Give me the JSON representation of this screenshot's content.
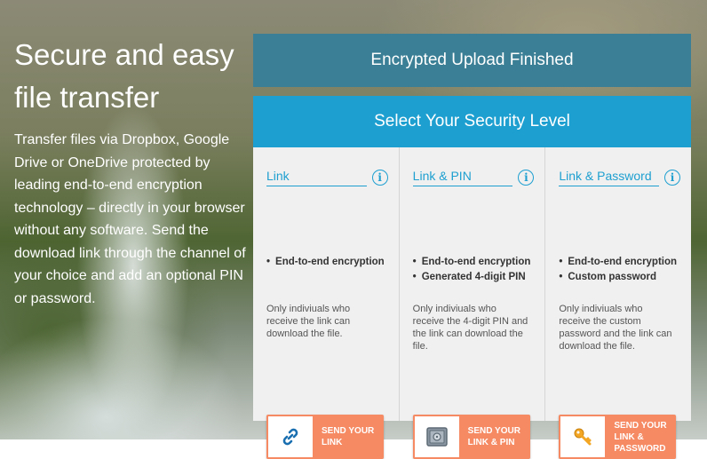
{
  "hero": {
    "title": "Secure and easy file transfer",
    "text": "Transfer files via Dropbox, Google Drive or OneDrive protected by leading end-to-end encryption technology – directly in your browser without any software. Send the download link through the channel of your choice and add an optional PIN or password."
  },
  "status_bar": {
    "label": "Encrypted Upload Finished"
  },
  "panel": {
    "title": "Select Your Security Level",
    "options": [
      {
        "title": "Link",
        "features": [
          "End-to-end encryption"
        ],
        "description": "Only indiviuals who receive the link can download the file.",
        "button_label": "Send your link",
        "icon": "link-icon"
      },
      {
        "title": "Link & PIN",
        "features": [
          "End-to-end encryption",
          "Generated 4-digit PIN"
        ],
        "description": "Only indiviuals who receive the 4-digit PIN and the link can download the file.",
        "button_label": "Send your link & PIN",
        "icon": "safe-icon"
      },
      {
        "title": "Link & Password",
        "features": [
          "End-to-end encryption",
          "Custom password"
        ],
        "description": "Only indiviuals who receive the custom password and the link can download the file.",
        "button_label": "Send your link & password",
        "icon": "key-icon"
      }
    ]
  },
  "colors": {
    "status_bar": "#3a7f95",
    "panel_header": "#1d9fd0",
    "button": "#f58a63"
  }
}
